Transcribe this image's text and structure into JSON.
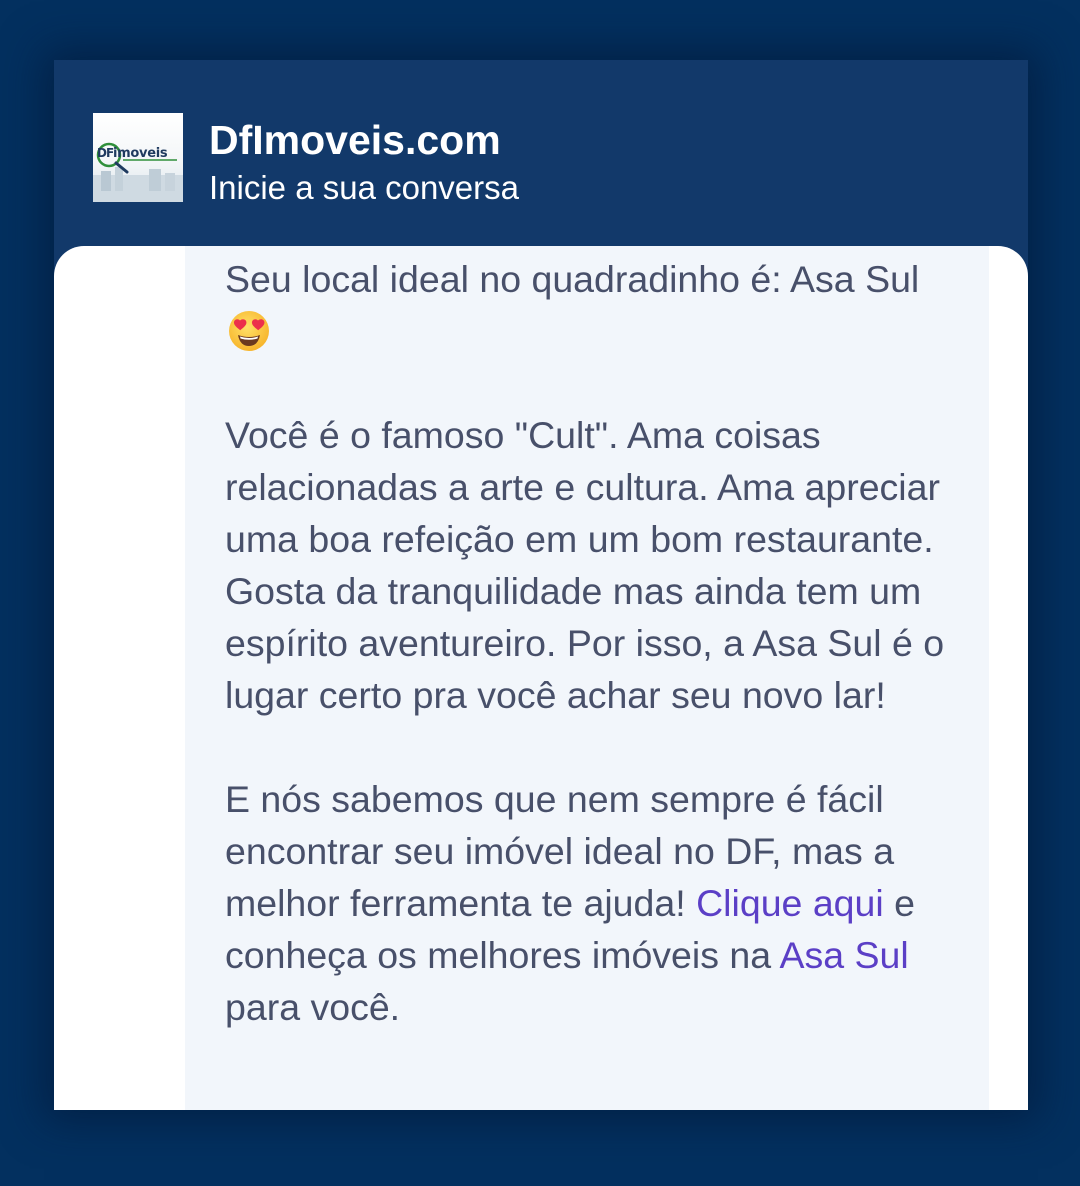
{
  "header": {
    "title": "DfImoveis.com",
    "subtitle": "Inicie a sua conversa",
    "logo_text": "imoveis",
    "logo_mark": "DF"
  },
  "message": {
    "p1_text": "Seu local ideal no quadradinho é:  Asa Sul",
    "p1_emoji_icon": "heart-eyes-emoji",
    "p2_text": "Você é o famoso \"Cult\". Ama coisas relacionadas a arte e cultura. Ama apreciar uma boa refeição em um bom restaurante. Gosta da tranquilidade mas ainda tem um espírito aventureiro. Por isso, a Asa Sul é o lugar certo pra você achar seu novo lar!",
    "p3_text_before": "E nós sabemos que nem sempre é fácil encontrar seu imóvel ideal no DF, mas a melhor ferramenta te ajuda!",
    "p3_link1": "Clique aqui",
    "p3_text_middle": "e conheça os melhores imóveis na",
    "p3_link2": "Asa Sul",
    "p3_text_after": "para você."
  },
  "colors": {
    "page_background": "#03305f",
    "header_background": "#12396a",
    "bubble_background": "#f2f6fb",
    "text": "#48506a",
    "link": "#5b3fc6"
  }
}
